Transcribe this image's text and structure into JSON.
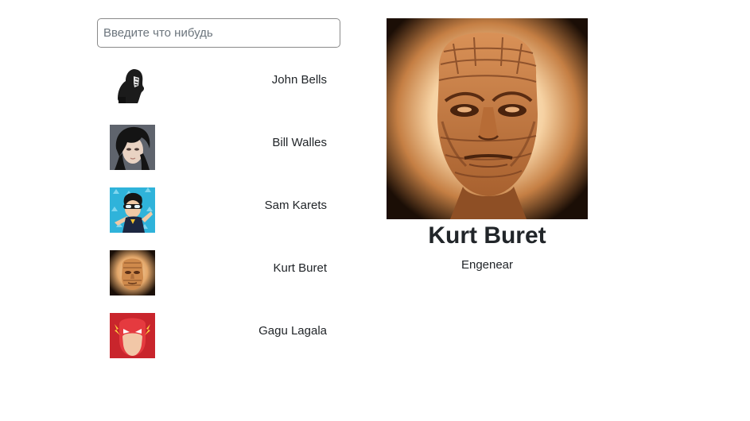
{
  "search": {
    "value": "",
    "placeholder": "Введите что нибудь"
  },
  "contacts": [
    {
      "name": "John Bells",
      "avatar_icon": "hooded-silhouette-avatar"
    },
    {
      "name": "Bill Walles",
      "avatar_icon": "dark-hair-portrait-avatar"
    },
    {
      "name": "Sam Karets",
      "avatar_icon": "goggles-hero-avatar"
    },
    {
      "name": "Kurt Buret",
      "avatar_icon": "mummy-face-avatar"
    },
    {
      "name": "Gagu Lagala",
      "avatar_icon": "red-masked-hero-avatar"
    }
  ],
  "selected": {
    "name": "Kurt Buret",
    "role": "Engenear",
    "photo_icon": "mummy-face-photo"
  }
}
